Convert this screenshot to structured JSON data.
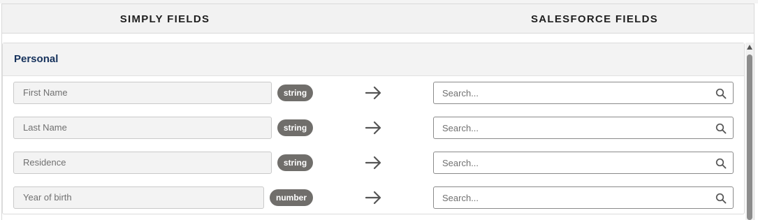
{
  "header": {
    "left_title": "SIMPLY FIELDS",
    "right_title": "SALESFORCE FIELDS"
  },
  "section": {
    "title": "Personal"
  },
  "rows": [
    {
      "field": "First Name",
      "type": "string",
      "search_placeholder": "Search..."
    },
    {
      "field": "Last Name",
      "type": "string",
      "search_placeholder": "Search..."
    },
    {
      "field": "Residence",
      "type": "string",
      "search_placeholder": "Search..."
    },
    {
      "field": "Year of birth",
      "type": "number",
      "search_placeholder": "Search..."
    }
  ],
  "icons": {
    "arrow": "arrow-right-icon",
    "search": "search-icon"
  },
  "colors": {
    "section_title": "#16325c",
    "badge_bg": "#706e6b"
  }
}
